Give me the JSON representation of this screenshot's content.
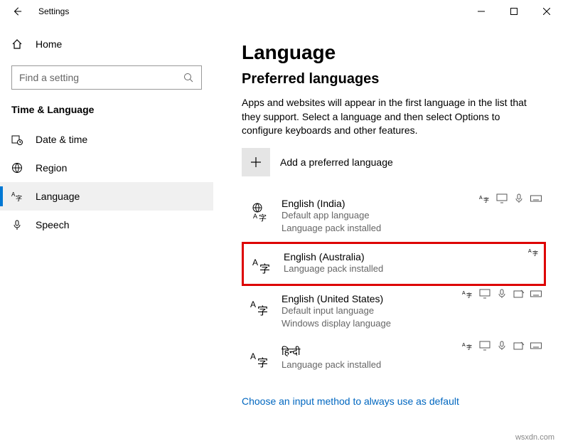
{
  "titlebar": {
    "title": "Settings"
  },
  "sidebar": {
    "home": "Home",
    "search_placeholder": "Find a setting",
    "category": "Time & Language",
    "items": [
      {
        "label": "Date & time"
      },
      {
        "label": "Region"
      },
      {
        "label": "Language"
      },
      {
        "label": "Speech"
      }
    ]
  },
  "main": {
    "heading": "Language",
    "subheading": "Preferred languages",
    "description": "Apps and websites will appear in the first language in the list that they support. Select a language and then select Options to configure keyboards and other features.",
    "add_label": "Add a preferred language",
    "languages": [
      {
        "name": "English (India)",
        "sub1": "Default app language",
        "sub2": "Language pack installed"
      },
      {
        "name": "English (Australia)",
        "sub1": "Language pack installed",
        "sub2": ""
      },
      {
        "name": "English (United States)",
        "sub1": "Default input language",
        "sub2": "Windows display language"
      },
      {
        "name": "हिन्दी",
        "sub1": "Language pack installed",
        "sub2": ""
      }
    ],
    "link": "Choose an input method to always use as default"
  },
  "watermark": "wsxdn.com"
}
